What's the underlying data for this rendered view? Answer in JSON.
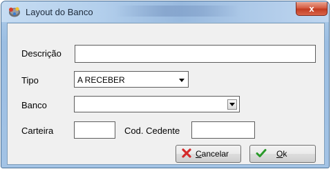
{
  "window": {
    "title": "Layout do Banco",
    "close_label": "x"
  },
  "form": {
    "descricao": {
      "label": "Descrição",
      "value": ""
    },
    "tipo": {
      "label": "Tipo",
      "value": "A RECEBER"
    },
    "banco": {
      "label": "Banco",
      "value": ""
    },
    "carteira": {
      "label": "Carteira",
      "value": ""
    },
    "cod_cedente": {
      "label": "Cod. Cedente",
      "value": ""
    }
  },
  "buttons": {
    "cancelar": {
      "mnemonic": "C",
      "rest": "ancelar",
      "icon": "red-x-icon"
    },
    "ok": {
      "mnemonic": "O",
      "rest": "k",
      "icon": "green-check-icon"
    }
  },
  "colors": {
    "accent": "#d4553a",
    "cancel_icon": "#d42a2a",
    "ok_icon": "#2a9a2a"
  }
}
